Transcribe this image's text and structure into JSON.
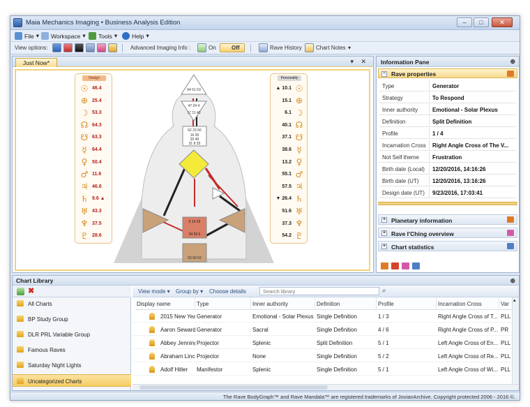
{
  "window": {
    "title": "Maia Mechanics Imaging • Business Analysis Edition",
    "controls": [
      "–",
      "□",
      "✕"
    ]
  },
  "menu": [
    {
      "label": "File",
      "icon": "file-icon",
      "color": "#5b8fd4"
    },
    {
      "label": "Workspace",
      "icon": "workspace-icon",
      "color": "#8fb0dd"
    },
    {
      "label": "Tools",
      "icon": "tools-icon",
      "color": "#4f9a3e"
    },
    {
      "label": "Help",
      "icon": "help-icon",
      "color": "#2d6fc4"
    }
  ],
  "toolbar": {
    "view_options_label": "View options:",
    "advanced_label": "Advanced Imaging Info :",
    "on_label": "On",
    "off_label": "Off",
    "rave_history_label": "Rave History",
    "chart_notes_label": "Chart Notes"
  },
  "document": {
    "tab_label": "Just Now*",
    "tab_controls": "▾ ✕"
  },
  "chart": {
    "design_header": "Design",
    "personality_header": "Personality",
    "design": [
      {
        "glyph": "☉",
        "value": "46.4"
      },
      {
        "glyph": "⊕",
        "value": "25.4"
      },
      {
        "glyph": "☽",
        "value": "53.3"
      },
      {
        "glyph": "☊",
        "value": "64.3"
      },
      {
        "glyph": "☋",
        "value": "63.3"
      },
      {
        "glyph": "☿",
        "value": "64.4"
      },
      {
        "glyph": "♀",
        "value": "50.4"
      },
      {
        "glyph": "♂",
        "value": "11.6"
      },
      {
        "glyph": "♃",
        "value": "46.6"
      },
      {
        "glyph": "♄",
        "value": "9.6 ▲"
      },
      {
        "glyph": "♅",
        "value": "43.3"
      },
      {
        "glyph": "♆",
        "value": "37.5"
      },
      {
        "glyph": "♇",
        "value": "28.6"
      }
    ],
    "personality": [
      {
        "glyph": "☉",
        "value": "▲ 10.1"
      },
      {
        "glyph": "⊕",
        "value": "15.1"
      },
      {
        "glyph": "☽",
        "value": "6.1"
      },
      {
        "glyph": "☊",
        "value": "40.1"
      },
      {
        "glyph": "☋",
        "value": "37.1"
      },
      {
        "glyph": "☿",
        "value": "38.6"
      },
      {
        "glyph": "♀",
        "value": "13.2"
      },
      {
        "glyph": "♂",
        "value": "55.1"
      },
      {
        "glyph": "♃",
        "value": "57.5"
      },
      {
        "glyph": "♄",
        "value": "▼ 26.4"
      },
      {
        "glyph": "♅",
        "value": "51.6"
      },
      {
        "glyph": "♆",
        "value": "37.3"
      },
      {
        "glyph": "♇",
        "value": "54.2"
      }
    ],
    "gate_labels": {
      "head": "64 61 63",
      "ajna": "47 24 4",
      "ajna_lower": "17 11 43",
      "throat_top": "62 23 56",
      "throat_mid": "16 35",
      "throat_low": "20 45",
      "throat_bottom": "31 8 33",
      "root": "53 60 52",
      "sacral": "5 14 29",
      "sacral_low": "34 59 9"
    }
  },
  "info_pane": {
    "title": "Information Pane",
    "pin": "⊕",
    "rave_properties_title": "Rave properties",
    "properties": [
      {
        "key": "Type",
        "value": "Generator"
      },
      {
        "key": "Strategy",
        "value": "To Respond"
      },
      {
        "key": "Inner authority",
        "value": "Emotional - Solar Plexus"
      },
      {
        "key": "Definition",
        "value": "Split Definition"
      },
      {
        "key": "Profile",
        "value": "1 / 4"
      },
      {
        "key": "Incarnation Cross",
        "value": "Right Angle Cross of The V..."
      },
      {
        "key": "Not Self theme",
        "value": "Frustration"
      },
      {
        "key": "Birth date (Local)",
        "value": "12/20/2016, 14:16:26"
      },
      {
        "key": "Birth date (UT)",
        "value": "12/20/2016, 13:16:26"
      },
      {
        "key": "Design date (UT)",
        "value": "9/23/2016, 17:03:41"
      }
    ],
    "sections": [
      {
        "label": "Planetary information",
        "icon_color": "#e07a26"
      },
      {
        "label": "Rave I'Ching overview",
        "icon_color": "#d45aa8"
      },
      {
        "label": "Chart statistics",
        "icon_color": "#4d7fc9"
      }
    ],
    "bottom_icon_colors": [
      "#e07a26",
      "#d8442e",
      "#d45aa8",
      "#4d7fc9"
    ]
  },
  "library": {
    "title": "Chart Library",
    "pin": "⊕",
    "toolbar": {
      "view_mode": "View mode",
      "group_by": "Group by",
      "choose_details": "Choose details",
      "search_placeholder": "Search library"
    },
    "groups": [
      {
        "label": "All Charts",
        "selected": false
      },
      {
        "label": "BP Study Group",
        "selected": false
      },
      {
        "label": "DLR PRL Variable Group",
        "selected": false
      },
      {
        "label": "Famous Raves",
        "selected": false
      },
      {
        "label": "Saturday Night Lights",
        "selected": false
      },
      {
        "label": "Uncategorized Charts",
        "selected": true
      }
    ],
    "columns": [
      "Display name",
      "Type",
      "Inner authority",
      "Definition",
      "Profile",
      "Incarnation Cross",
      "Var"
    ],
    "rows": [
      {
        "name": "2015 New Year",
        "type": "Generator",
        "authority": "Emotional - Solar Plexus",
        "definition": "Single Definition",
        "profile": "1 / 3",
        "cross": "Right Angle Cross of T...",
        "var": "PLL"
      },
      {
        "name": "Aaron Seward",
        "type": "Generator",
        "authority": "Sacral",
        "definition": "Single Definition",
        "profile": "4 / 6",
        "cross": "Right Angle Cross of P...",
        "var": "PR"
      },
      {
        "name": "Abbey Jennings",
        "type": "Projector",
        "authority": "Splenic",
        "definition": "Split Definition",
        "profile": "5 / 1",
        "cross": "Left Angle Cross of En...",
        "var": "PLL"
      },
      {
        "name": "Abraham Lincoln",
        "type": "Projector",
        "authority": "None",
        "definition": "Single Definition",
        "profile": "5 / 2",
        "cross": "Left Angle Cross of Re...",
        "var": "PLL"
      },
      {
        "name": "Adolf Hitler",
        "type": "Manifestor",
        "authority": "Splenic",
        "definition": "Single Definition",
        "profile": "5 / 1",
        "cross": "Left Angle Cross of Wi...",
        "var": "PLL"
      }
    ]
  },
  "status": {
    "text": "The Rave BodyGraph™ and Rave Mandala™ are registered trademarks of JovianArchive. Copyright protected 2006 - 2016 ©."
  }
}
